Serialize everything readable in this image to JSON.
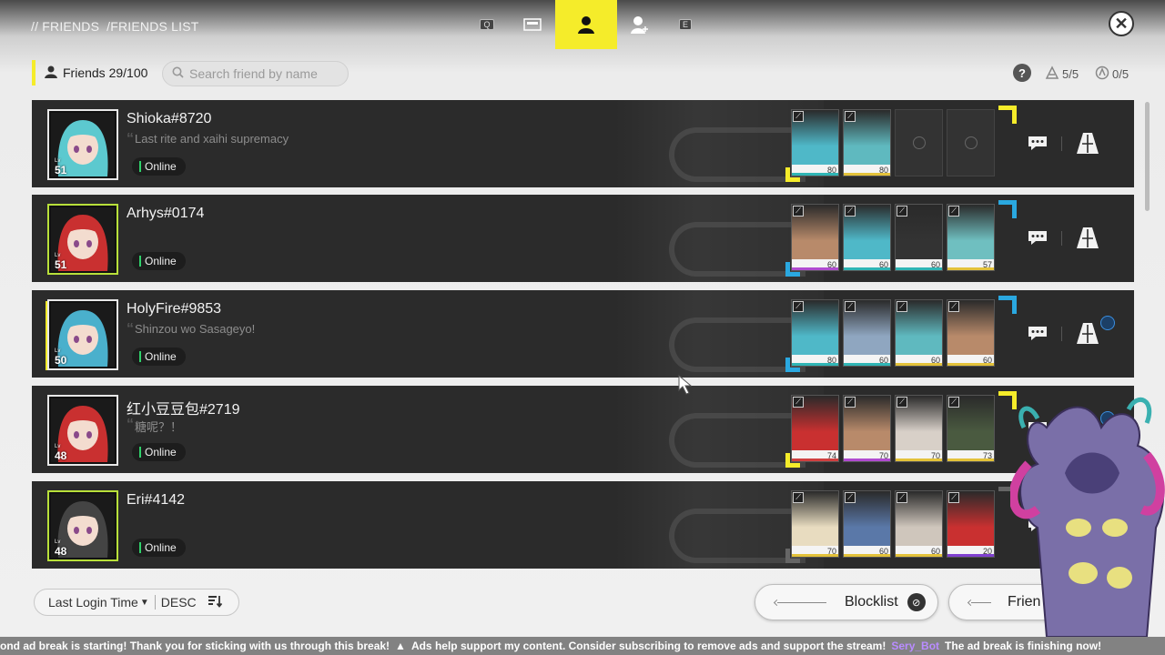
{
  "header": {
    "breadcrumb": [
      "// FRIENDS",
      "/FRIENDS LIST"
    ],
    "nav": [
      {
        "key": "Q",
        "icon": "q-key-icon"
      },
      {
        "key": "",
        "icon": "card-icon"
      },
      {
        "key": "",
        "icon": "friends-icon",
        "active": true
      },
      {
        "key": "",
        "icon": "add-friend-icon"
      },
      {
        "key": "E",
        "icon": "e-key-icon"
      }
    ],
    "close_label": "✕"
  },
  "toolbar": {
    "friends_count": "Friends 29/100",
    "search_placeholder": "Search friend by name",
    "help_label": "?",
    "support_stat": "5/5",
    "clue_stat": "0/5"
  },
  "friends": [
    {
      "name": "Shioka#8720",
      "motto": "Last rite and xaihi supremacy",
      "status": "Online",
      "level": "51",
      "avatar_color": "#4fb8c8",
      "hair": "#5cc9cf",
      "corner": "y",
      "units": [
        {
          "lv": "80",
          "c": "#4fb8c8",
          "s": "#2fb5b5"
        },
        {
          "lv": "80",
          "c": "#5fb9bf",
          "s": "#e3c23a"
        },
        {
          "lv": "",
          "c": "",
          "s": ""
        },
        {
          "lv": "",
          "c": "",
          "s": ""
        }
      ]
    },
    {
      "name": "Arhys#0174",
      "motto": "",
      "status": "Online",
      "level": "51",
      "avatar_color": "#d83a3a",
      "hair": "#c93030",
      "corner": "b",
      "units": [
        {
          "lv": "60",
          "c": "#b88a6a",
          "s": "#b04bd0"
        },
        {
          "lv": "60",
          "c": "#4fb8c8",
          "s": "#2fb5b5"
        },
        {
          "lv": "60",
          "c": "#333333",
          "s": "#2fb5b5"
        },
        {
          "lv": "57",
          "c": "#6fbfc0",
          "s": "#e3c23a"
        }
      ]
    },
    {
      "name": "HolyFire#9853",
      "motto": "Shinzou wo Sasageyo!",
      "status": "Online",
      "level": "50",
      "avatar_color": "#4fb8c8",
      "hair": "#4ab0cc",
      "corner": "b",
      "units": [
        {
          "lv": "80",
          "c": "#4fb8c8",
          "s": "#2fb5b5"
        },
        {
          "lv": "60",
          "c": "#8fa6c0",
          "s": "#2fb5b5"
        },
        {
          "lv": "60",
          "c": "#5fb9bf",
          "s": "#e3c23a"
        },
        {
          "lv": "60",
          "c": "#b88a6a",
          "s": "#e3c23a"
        }
      ]
    },
    {
      "name": "红小豆豆包#2719",
      "motto": "糖呢？！",
      "status": "Online",
      "level": "48",
      "avatar_color": "#d83a3a",
      "hair": "#c93030",
      "corner": "y",
      "units": [
        {
          "lv": "74",
          "c": "#c93030",
          "s": "#d04040"
        },
        {
          "lv": "70",
          "c": "#b88a6a",
          "s": "#b04bd0"
        },
        {
          "lv": "70",
          "c": "#d8d0c8",
          "s": "#e3c23a"
        },
        {
          "lv": "73",
          "c": "#4a5a40",
          "s": "#e3c23a"
        }
      ]
    },
    {
      "name": "Eri#4142",
      "motto": "",
      "status": "Online",
      "level": "48",
      "avatar_color": "#3a3a3a",
      "hair": "#444444",
      "corner": "g",
      "units": [
        {
          "lv": "70",
          "c": "#e8dcc0",
          "s": "#e3c23a"
        },
        {
          "lv": "60",
          "c": "#5a78a8",
          "s": "#e3c23a"
        },
        {
          "lv": "60",
          "c": "#cfc6bc",
          "s": "#e3c23a"
        },
        {
          "lv": "20",
          "c": "#c93030",
          "s": "#8040d0"
        }
      ]
    }
  ],
  "footer": {
    "sort_field": "Last Login Time",
    "sort_order": "DESC",
    "blocklist_label": "Blocklist",
    "friend_label": "Frien"
  },
  "stream": {
    "ticker_a": "ond ad break is starting! Thank you for sticking with us through this break!",
    "ticker_b": "Ads help support my content. Consider subscribing to remove ads and support the stream!",
    "bot_name": "Sery_Bot",
    "ticker_c": "The ad break is finishing now!"
  },
  "colors": {
    "accent": "#f5ec2a",
    "online": "#2fd06a",
    "row_bg": "#2b2b2b"
  }
}
